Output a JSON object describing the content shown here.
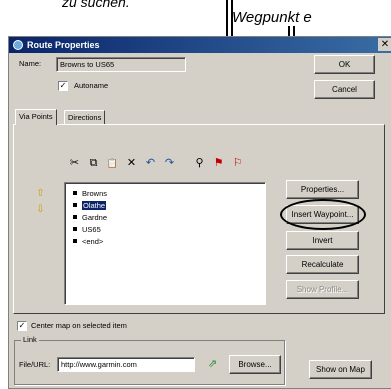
{
  "captions": {
    "left": "zu suchen.",
    "right": "Wegpunkt e"
  },
  "window": {
    "title": "Route Properties",
    "close_glyph": "✕"
  },
  "name": {
    "label": "Name:",
    "value": "Browns to US65"
  },
  "autoname": {
    "label": "Autoname",
    "checked": true
  },
  "buttons": {
    "ok": "OK",
    "cancel": "Cancel",
    "properties": "Properties...",
    "insert_waypoint": "Insert Waypoint...",
    "invert": "Invert",
    "recalculate": "Recalculate",
    "show_profile": "Show Profile...",
    "browse": "Browse...",
    "show_on_map": "Show on Map"
  },
  "tabs": [
    {
      "label": "Via Points",
      "active": true
    },
    {
      "label": "Directions",
      "active": false
    }
  ],
  "toolbar": {
    "cut": "✂",
    "copy": "⧉",
    "paste": "📋",
    "delete": "✕",
    "undo": "↶",
    "redo": "↷",
    "find": "⚲",
    "find_next": "⚑",
    "find_prev": "⚐"
  },
  "move_buttons": {
    "up": "⇧",
    "down": "⇩"
  },
  "via_points": [
    {
      "label": "Browns",
      "selected": false
    },
    {
      "label": "Olathe",
      "selected": true
    },
    {
      "label": "Gardne",
      "selected": false
    },
    {
      "label": "US65",
      "selected": false
    },
    {
      "label": "<end>",
      "selected": false
    }
  ],
  "center_map": {
    "label": "Center map on selected item",
    "checked": true
  },
  "link": {
    "group_label": "Link",
    "field_label": "File/URL:",
    "value": "http://www.garmin.com",
    "go_glyph": "⇗"
  },
  "colors": {
    "title_bar": "#0a246a",
    "dialog_bg": "#d4d0c8",
    "selection": "#0a246a",
    "arrow_yellow": "#c8a000"
  }
}
